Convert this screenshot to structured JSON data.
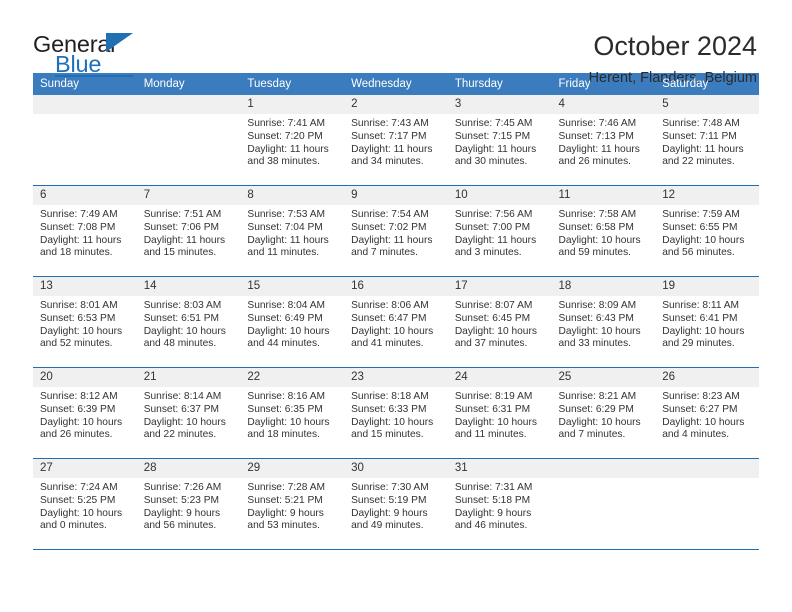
{
  "brand": {
    "name_part1": "General",
    "name_part2": "Blue"
  },
  "header": {
    "title": "October 2024",
    "subtitle": "Herent, Flanders, Belgium"
  },
  "colors": {
    "header_blue": "#3a7cbe",
    "rule_blue": "#1f6fb2",
    "daynum_band": "#f0f0f0",
    "text": "#333333"
  },
  "weekdays": [
    "Sunday",
    "Monday",
    "Tuesday",
    "Wednesday",
    "Thursday",
    "Friday",
    "Saturday"
  ],
  "calendar": {
    "weeks": [
      [
        {
          "day": "",
          "sunrise": "",
          "sunset": "",
          "daylight_line1": "",
          "daylight_line2": ""
        },
        {
          "day": "",
          "sunrise": "",
          "sunset": "",
          "daylight_line1": "",
          "daylight_line2": ""
        },
        {
          "day": "1",
          "sunrise": "Sunrise: 7:41 AM",
          "sunset": "Sunset: 7:20 PM",
          "daylight_line1": "Daylight: 11 hours",
          "daylight_line2": "and 38 minutes."
        },
        {
          "day": "2",
          "sunrise": "Sunrise: 7:43 AM",
          "sunset": "Sunset: 7:17 PM",
          "daylight_line1": "Daylight: 11 hours",
          "daylight_line2": "and 34 minutes."
        },
        {
          "day": "3",
          "sunrise": "Sunrise: 7:45 AM",
          "sunset": "Sunset: 7:15 PM",
          "daylight_line1": "Daylight: 11 hours",
          "daylight_line2": "and 30 minutes."
        },
        {
          "day": "4",
          "sunrise": "Sunrise: 7:46 AM",
          "sunset": "Sunset: 7:13 PM",
          "daylight_line1": "Daylight: 11 hours",
          "daylight_line2": "and 26 minutes."
        },
        {
          "day": "5",
          "sunrise": "Sunrise: 7:48 AM",
          "sunset": "Sunset: 7:11 PM",
          "daylight_line1": "Daylight: 11 hours",
          "daylight_line2": "and 22 minutes."
        }
      ],
      [
        {
          "day": "6",
          "sunrise": "Sunrise: 7:49 AM",
          "sunset": "Sunset: 7:08 PM",
          "daylight_line1": "Daylight: 11 hours",
          "daylight_line2": "and 18 minutes."
        },
        {
          "day": "7",
          "sunrise": "Sunrise: 7:51 AM",
          "sunset": "Sunset: 7:06 PM",
          "daylight_line1": "Daylight: 11 hours",
          "daylight_line2": "and 15 minutes."
        },
        {
          "day": "8",
          "sunrise": "Sunrise: 7:53 AM",
          "sunset": "Sunset: 7:04 PM",
          "daylight_line1": "Daylight: 11 hours",
          "daylight_line2": "and 11 minutes."
        },
        {
          "day": "9",
          "sunrise": "Sunrise: 7:54 AM",
          "sunset": "Sunset: 7:02 PM",
          "daylight_line1": "Daylight: 11 hours",
          "daylight_line2": "and 7 minutes."
        },
        {
          "day": "10",
          "sunrise": "Sunrise: 7:56 AM",
          "sunset": "Sunset: 7:00 PM",
          "daylight_line1": "Daylight: 11 hours",
          "daylight_line2": "and 3 minutes."
        },
        {
          "day": "11",
          "sunrise": "Sunrise: 7:58 AM",
          "sunset": "Sunset: 6:58 PM",
          "daylight_line1": "Daylight: 10 hours",
          "daylight_line2": "and 59 minutes."
        },
        {
          "day": "12",
          "sunrise": "Sunrise: 7:59 AM",
          "sunset": "Sunset: 6:55 PM",
          "daylight_line1": "Daylight: 10 hours",
          "daylight_line2": "and 56 minutes."
        }
      ],
      [
        {
          "day": "13",
          "sunrise": "Sunrise: 8:01 AM",
          "sunset": "Sunset: 6:53 PM",
          "daylight_line1": "Daylight: 10 hours",
          "daylight_line2": "and 52 minutes."
        },
        {
          "day": "14",
          "sunrise": "Sunrise: 8:03 AM",
          "sunset": "Sunset: 6:51 PM",
          "daylight_line1": "Daylight: 10 hours",
          "daylight_line2": "and 48 minutes."
        },
        {
          "day": "15",
          "sunrise": "Sunrise: 8:04 AM",
          "sunset": "Sunset: 6:49 PM",
          "daylight_line1": "Daylight: 10 hours",
          "daylight_line2": "and 44 minutes."
        },
        {
          "day": "16",
          "sunrise": "Sunrise: 8:06 AM",
          "sunset": "Sunset: 6:47 PM",
          "daylight_line1": "Daylight: 10 hours",
          "daylight_line2": "and 41 minutes."
        },
        {
          "day": "17",
          "sunrise": "Sunrise: 8:07 AM",
          "sunset": "Sunset: 6:45 PM",
          "daylight_line1": "Daylight: 10 hours",
          "daylight_line2": "and 37 minutes."
        },
        {
          "day": "18",
          "sunrise": "Sunrise: 8:09 AM",
          "sunset": "Sunset: 6:43 PM",
          "daylight_line1": "Daylight: 10 hours",
          "daylight_line2": "and 33 minutes."
        },
        {
          "day": "19",
          "sunrise": "Sunrise: 8:11 AM",
          "sunset": "Sunset: 6:41 PM",
          "daylight_line1": "Daylight: 10 hours",
          "daylight_line2": "and 29 minutes."
        }
      ],
      [
        {
          "day": "20",
          "sunrise": "Sunrise: 8:12 AM",
          "sunset": "Sunset: 6:39 PM",
          "daylight_line1": "Daylight: 10 hours",
          "daylight_line2": "and 26 minutes."
        },
        {
          "day": "21",
          "sunrise": "Sunrise: 8:14 AM",
          "sunset": "Sunset: 6:37 PM",
          "daylight_line1": "Daylight: 10 hours",
          "daylight_line2": "and 22 minutes."
        },
        {
          "day": "22",
          "sunrise": "Sunrise: 8:16 AM",
          "sunset": "Sunset: 6:35 PM",
          "daylight_line1": "Daylight: 10 hours",
          "daylight_line2": "and 18 minutes."
        },
        {
          "day": "23",
          "sunrise": "Sunrise: 8:18 AM",
          "sunset": "Sunset: 6:33 PM",
          "daylight_line1": "Daylight: 10 hours",
          "daylight_line2": "and 15 minutes."
        },
        {
          "day": "24",
          "sunrise": "Sunrise: 8:19 AM",
          "sunset": "Sunset: 6:31 PM",
          "daylight_line1": "Daylight: 10 hours",
          "daylight_line2": "and 11 minutes."
        },
        {
          "day": "25",
          "sunrise": "Sunrise: 8:21 AM",
          "sunset": "Sunset: 6:29 PM",
          "daylight_line1": "Daylight: 10 hours",
          "daylight_line2": "and 7 minutes."
        },
        {
          "day": "26",
          "sunrise": "Sunrise: 8:23 AM",
          "sunset": "Sunset: 6:27 PM",
          "daylight_line1": "Daylight: 10 hours",
          "daylight_line2": "and 4 minutes."
        }
      ],
      [
        {
          "day": "27",
          "sunrise": "Sunrise: 7:24 AM",
          "sunset": "Sunset: 5:25 PM",
          "daylight_line1": "Daylight: 10 hours",
          "daylight_line2": "and 0 minutes."
        },
        {
          "day": "28",
          "sunrise": "Sunrise: 7:26 AM",
          "sunset": "Sunset: 5:23 PM",
          "daylight_line1": "Daylight: 9 hours",
          "daylight_line2": "and 56 minutes."
        },
        {
          "day": "29",
          "sunrise": "Sunrise: 7:28 AM",
          "sunset": "Sunset: 5:21 PM",
          "daylight_line1": "Daylight: 9 hours",
          "daylight_line2": "and 53 minutes."
        },
        {
          "day": "30",
          "sunrise": "Sunrise: 7:30 AM",
          "sunset": "Sunset: 5:19 PM",
          "daylight_line1": "Daylight: 9 hours",
          "daylight_line2": "and 49 minutes."
        },
        {
          "day": "31",
          "sunrise": "Sunrise: 7:31 AM",
          "sunset": "Sunset: 5:18 PM",
          "daylight_line1": "Daylight: 9 hours",
          "daylight_line2": "and 46 minutes."
        },
        {
          "day": "",
          "sunrise": "",
          "sunset": "",
          "daylight_line1": "",
          "daylight_line2": ""
        },
        {
          "day": "",
          "sunrise": "",
          "sunset": "",
          "daylight_line1": "",
          "daylight_line2": ""
        }
      ]
    ]
  }
}
